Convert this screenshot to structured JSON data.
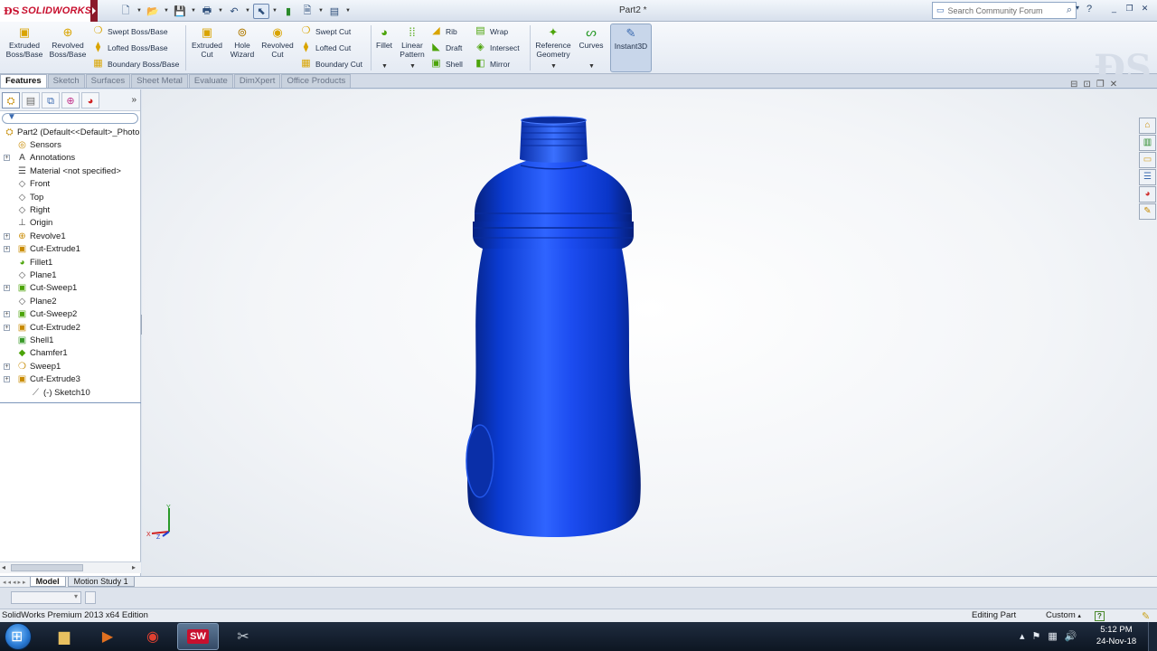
{
  "app": {
    "logo": "SOLIDWORKS",
    "doc_title": "Part2 *",
    "search_placeholder": "Search Community Forum"
  },
  "ribbon": {
    "extruded_boss": "Extruded Boss/Base",
    "revolved_boss": "Revolved Boss/Base",
    "swept_boss": "Swept Boss/Base",
    "lofted_boss": "Lofted Boss/Base",
    "boundary_boss": "Boundary Boss/Base",
    "extruded_cut": "Extruded Cut",
    "hole_wizard": "Hole Wizard",
    "revolved_cut": "Revolved Cut",
    "swept_cut": "Swept Cut",
    "lofted_cut": "Lofted Cut",
    "boundary_cut": "Boundary Cut",
    "fillet": "Fillet",
    "linear_pattern": "Linear Pattern",
    "rib": "Rib",
    "draft": "Draft",
    "shell": "Shell",
    "wrap": "Wrap",
    "intersect": "Intersect",
    "mirror": "Mirror",
    "reference_geometry": "Reference Geometry",
    "curves": "Curves",
    "instant3d": "Instant3D"
  },
  "tabs": [
    "Features",
    "Sketch",
    "Surfaces",
    "Sheet Metal",
    "Evaluate",
    "DimXpert",
    "Office Products"
  ],
  "tree": [
    {
      "label": "Part2  (Default<<Default>_Photo",
      "icon": "part-icon",
      "level": 0,
      "expand": false
    },
    {
      "label": "Sensors",
      "icon": "sensor-icon",
      "level": 1,
      "expand": false
    },
    {
      "label": "Annotations",
      "icon": "annotation-icon",
      "level": 1,
      "expand": true
    },
    {
      "label": "Material <not specified>",
      "icon": "material-icon",
      "level": 1,
      "expand": false
    },
    {
      "label": "Front",
      "icon": "plane-icon",
      "level": 1,
      "expand": false
    },
    {
      "label": "Top",
      "icon": "plane-icon",
      "level": 1,
      "expand": false
    },
    {
      "label": "Right",
      "icon": "plane-icon",
      "level": 1,
      "expand": false
    },
    {
      "label": "Origin",
      "icon": "origin-icon",
      "level": 1,
      "expand": false
    },
    {
      "label": "Revolve1",
      "icon": "revolve-icon",
      "level": 1,
      "expand": true
    },
    {
      "label": "Cut-Extrude1",
      "icon": "cut-extrude-icon",
      "level": 1,
      "expand": true
    },
    {
      "label": "Fillet1",
      "icon": "fillet-icon",
      "level": 1,
      "expand": false
    },
    {
      "label": "Plane1",
      "icon": "plane-icon",
      "level": 1,
      "expand": false
    },
    {
      "label": "Cut-Sweep1",
      "icon": "cut-sweep-icon",
      "level": 1,
      "expand": true
    },
    {
      "label": "Plane2",
      "icon": "plane-icon",
      "level": 1,
      "expand": false
    },
    {
      "label": "Cut-Sweep2",
      "icon": "cut-sweep-icon",
      "level": 1,
      "expand": true
    },
    {
      "label": "Cut-Extrude2",
      "icon": "cut-extrude-icon",
      "level": 1,
      "expand": true
    },
    {
      "label": "Shell1",
      "icon": "shell-icon",
      "level": 1,
      "expand": false
    },
    {
      "label": "Chamfer1",
      "icon": "chamfer-icon",
      "level": 1,
      "expand": false
    },
    {
      "label": "Sweep1",
      "icon": "sweep-icon",
      "level": 1,
      "expand": true
    },
    {
      "label": "Cut-Extrude3",
      "icon": "cut-extrude-icon",
      "level": 1,
      "expand": true
    },
    {
      "label": "(-) Sketch10",
      "icon": "sketch-icon",
      "level": 2,
      "expand": false
    }
  ],
  "bottom_tabs": [
    "Model",
    "Motion Study 1"
  ],
  "status": {
    "edition": "SolidWorks Premium 2013 x64 Edition",
    "mode": "Editing Part",
    "units": "Custom"
  },
  "taskbar": {
    "time": "5:12 PM",
    "date": "24-Nov-18"
  },
  "colors": {
    "model_blue": "#0a3fd6",
    "accent_red": "#c8102e"
  }
}
